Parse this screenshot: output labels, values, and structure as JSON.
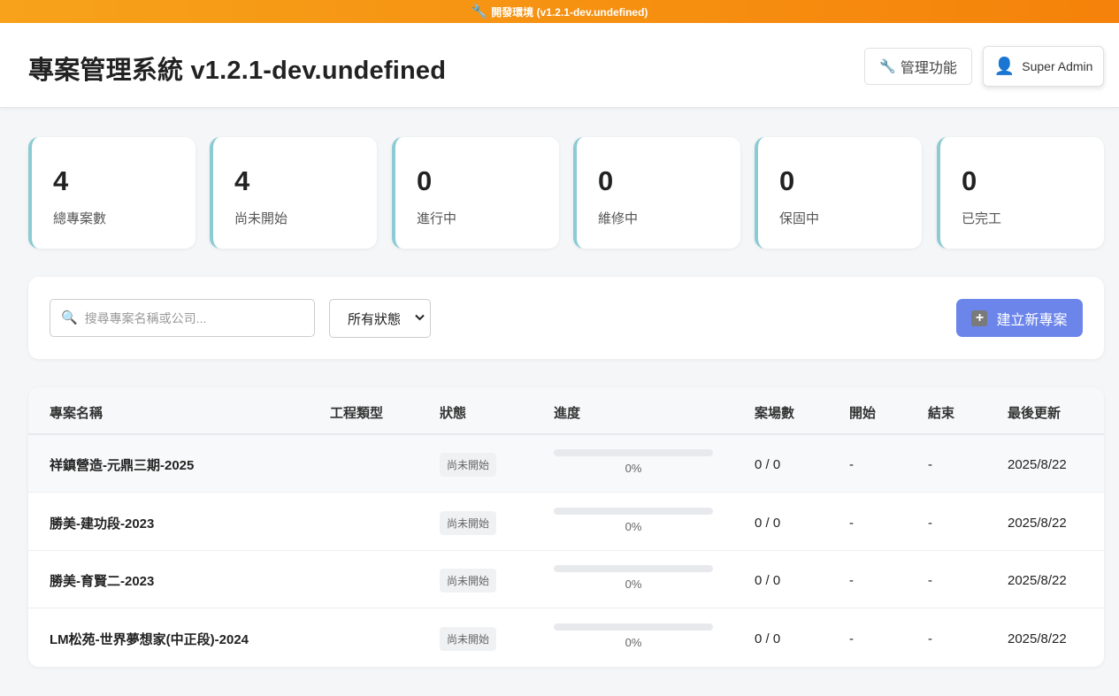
{
  "env_banner": {
    "icon": "wrench-icon",
    "text": "開發環境 (v1.2.1-dev.undefined)"
  },
  "header": {
    "title": "專案管理系統 v1.2.1-dev.undefined",
    "admin_button": {
      "icon": "wrench-icon",
      "label": "管理功能"
    },
    "user_button": {
      "icon": "user-icon",
      "label": "Super Admin"
    }
  },
  "stats": [
    {
      "value": "4",
      "label": "總專案數"
    },
    {
      "value": "4",
      "label": "尚未開始"
    },
    {
      "value": "0",
      "label": "進行中"
    },
    {
      "value": "0",
      "label": "維修中"
    },
    {
      "value": "0",
      "label": "保固中"
    },
    {
      "value": "0",
      "label": "已完工"
    }
  ],
  "toolbar": {
    "search_placeholder": "搜尋專案名稱或公司...",
    "status_filter": "所有狀態",
    "create_button": "建立新專案"
  },
  "table": {
    "headers": [
      "專案名稱",
      "工程類型",
      "狀態",
      "進度",
      "案場數",
      "開始",
      "結束",
      "最後更新"
    ],
    "rows": [
      {
        "name": "祥鎮營造-元鼎三期-2025",
        "type": "",
        "status": "尚未開始",
        "progress": 0,
        "progress_text": "0%",
        "sites": "0 / 0",
        "start": "-",
        "end": "-",
        "updated": "2025/8/22"
      },
      {
        "name": "勝美-建功段-2023",
        "type": "",
        "status": "尚未開始",
        "progress": 0,
        "progress_text": "0%",
        "sites": "0 / 0",
        "start": "-",
        "end": "-",
        "updated": "2025/8/22"
      },
      {
        "name": "勝美-育賢二-2023",
        "type": "",
        "status": "尚未開始",
        "progress": 0,
        "progress_text": "0%",
        "sites": "0 / 0",
        "start": "-",
        "end": "-",
        "updated": "2025/8/22"
      },
      {
        "name": "LM松苑-世界夢想家(中正段)-2024",
        "type": "",
        "status": "尚未開始",
        "progress": 0,
        "progress_text": "0%",
        "sites": "0 / 0",
        "start": "-",
        "end": "-",
        "updated": "2025/8/22"
      }
    ]
  },
  "colors": {
    "banner": "#f5820a",
    "accent": "#6c85ea",
    "card_border": "#8ccbd3"
  }
}
